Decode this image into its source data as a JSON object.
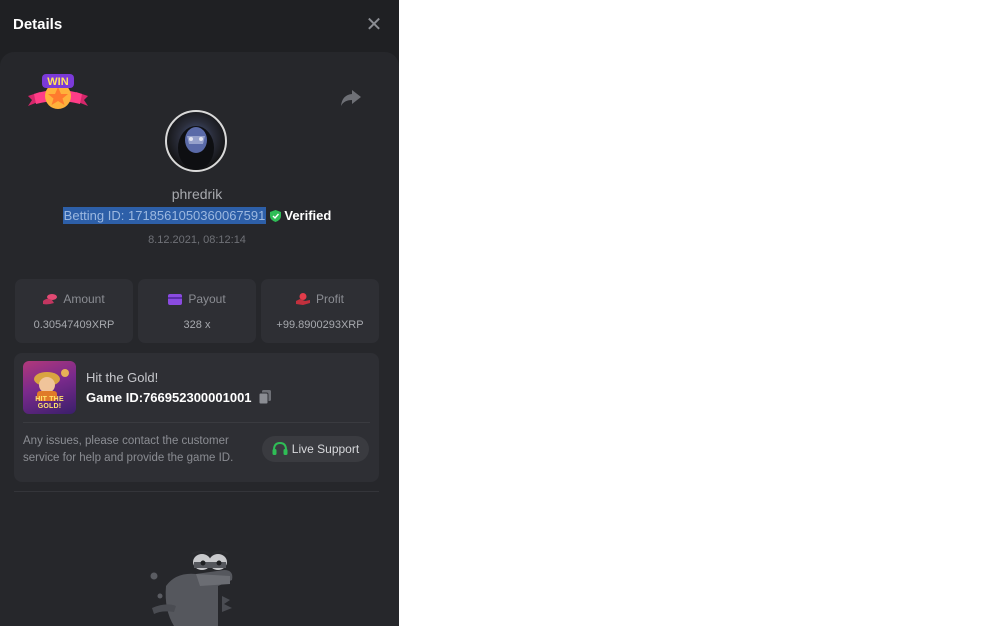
{
  "header": {
    "title": "Details",
    "close_label": "✕"
  },
  "player": {
    "username": "phredrik",
    "betting_id": "Betting ID: 171856105036006759​1",
    "verified": "Verified",
    "timestamp": "8.12.2021, 08:12:14"
  },
  "badge": {
    "text": "WIN"
  },
  "stats": [
    {
      "label": "Amount",
      "value": "0.30547409XRP",
      "icon": "coins-icon"
    },
    {
      "label": "Payout",
      "value": "328 x",
      "icon": "card-icon"
    },
    {
      "label": "Profit",
      "value": "+99.8900293XRP",
      "icon": "hand-coin-icon"
    }
  ],
  "game": {
    "title": "Hit the Gold!",
    "id_label": "Game ID:",
    "id_value": "766952300001001",
    "thumb_text": "HIT THE GOLD!"
  },
  "support": {
    "message": "Any issues, please contact the customer service for help and provide the game ID.",
    "button_label": "Live Support"
  },
  "colors": {
    "panel_bg": "#1f2023",
    "card_bg": "#26272b",
    "box_bg": "#2e2f34",
    "verified_green": "#2fbd56",
    "selection_blue": "#2d5fa8"
  }
}
